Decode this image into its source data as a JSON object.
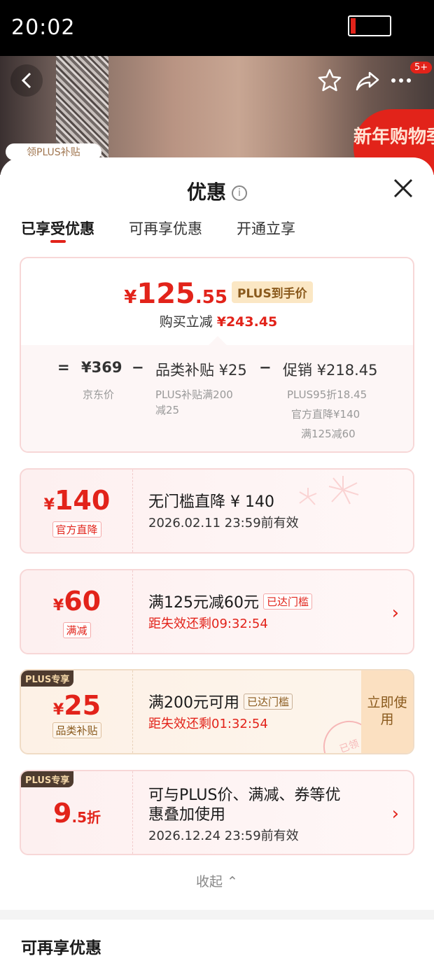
{
  "status_bar": {
    "time": "20:02"
  },
  "hero": {
    "badge": "5+",
    "promo_banner": "新年购物季",
    "plus_tag": "领PLUS补贴"
  },
  "sheet": {
    "title": "优惠",
    "info_glyph": "i",
    "tabs": [
      "已享受优惠",
      "可再享优惠",
      "开通立享"
    ]
  },
  "summary": {
    "price_yen": "¥",
    "price_int": "125",
    "price_dec": ".55",
    "price_tag": "PLUS到手价",
    "reduce_label": "购买立减",
    "reduce_amount": "¥243.45",
    "eq": "=",
    "minus": "−",
    "jd_price": "¥369",
    "jd_price_label": "京东价",
    "category_subsidy": "品类补贴 ¥25",
    "category_subsidy_desc": [
      "PLUS补贴满200",
      "减25"
    ],
    "promotion": "促销 ¥218.45",
    "promotion_desc": [
      "PLUS95折18.45",
      "官方直降¥140",
      "满125减60"
    ]
  },
  "coupons": [
    {
      "yen": "¥",
      "num": "140",
      "suffix": "",
      "tag": "官方直降",
      "title": "无门槛直降 ¥ 140",
      "sub": "2026.02.11 23:59前有效"
    },
    {
      "yen": "¥",
      "num": "60",
      "suffix": "",
      "tag": "满减",
      "title": "满125元减60元",
      "reached": "已达门槛",
      "sub": "距失效还剩09:32:54",
      "arrow": "›"
    },
    {
      "plus_flag": "PLUS专享",
      "yen": "¥",
      "num": "25",
      "suffix": "",
      "tag": "品类补贴",
      "title": "满200元可用",
      "reached": "已达门槛",
      "sub": "距失效还剩01:32:54",
      "button": "立即使用",
      "stamp": "已领"
    },
    {
      "plus_flag": "PLUS专享",
      "yen": "",
      "num": "9",
      "suffix": ".5折",
      "title_line1": "可与PLUS价、满减、券等优",
      "title_line2": "惠叠加使用",
      "sub": "2026.12.24 23:59前有效",
      "arrow": "›"
    }
  ],
  "collapse_label": "收起 ⌃",
  "section_title": "可再享优惠",
  "colors": {
    "accent_red": "#e2231a",
    "plus_gold": "#8a5a1d",
    "card_border": "#f7d7d7"
  }
}
